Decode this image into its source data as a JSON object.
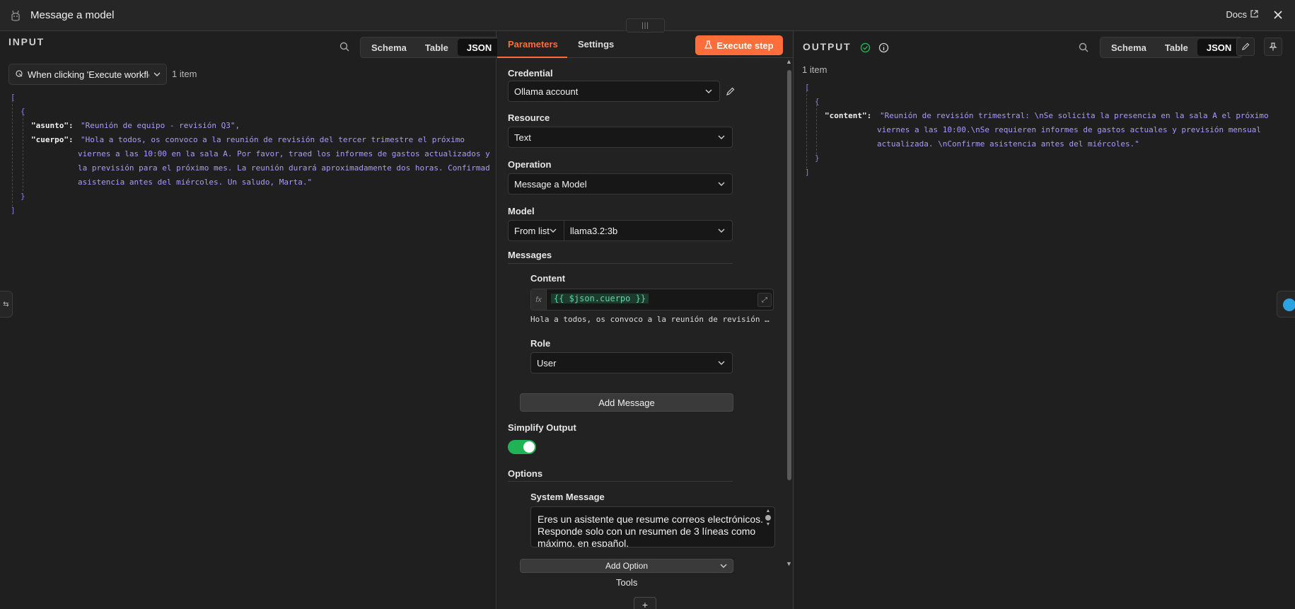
{
  "window": {
    "title": "Message a model",
    "docs_label": "Docs"
  },
  "view_tabs": [
    "Schema",
    "Table",
    "JSON"
  ],
  "input": {
    "label": "INPUT",
    "trigger_select": "When clicking 'Execute workflow'",
    "item_count": "1 item",
    "json": {
      "open_array": "[",
      "open_obj": "{",
      "asunto_key": "\"asunto\":",
      "asunto_val": "\"Reunión de equipo - revisión Q3\",",
      "cuerpo_key": "\"cuerpo\":",
      "cuerpo_lines": [
        "\"Hola a todos, os convoco a la reunión de revisión del tercer trimestre el próximo",
        "viernes a las 10:00 en la sala A. Por favor, traed los informes de gastos actualizados y",
        "la previsión para el próximo mes. La reunión durará aproximadamente dos horas. Confirmad",
        "asistencia antes del miércoles. Un saludo, Marta.\""
      ],
      "close_obj": "}",
      "close_array": "]"
    }
  },
  "params": {
    "tabs": {
      "parameters": "Parameters",
      "settings": "Settings"
    },
    "execute_label": "Execute step",
    "credential": {
      "label": "Credential",
      "value": "Ollama account"
    },
    "resource": {
      "label": "Resource",
      "value": "Text"
    },
    "operation": {
      "label": "Operation",
      "value": "Message a Model"
    },
    "model": {
      "label": "Model",
      "mode": "From list",
      "value": "llama3.2:3b"
    },
    "messages": {
      "label": "Messages",
      "content_label": "Content",
      "expression": "{{ $json.cuerpo }}",
      "preview": "Hola a todos, os convoco a la reunión de revisión …",
      "role_label": "Role",
      "role_value": "User",
      "add_label": "Add Message"
    },
    "simplify": {
      "label": "Simplify Output",
      "on": true
    },
    "options": {
      "label": "Options",
      "system_message_label": "System Message",
      "system_message": "Eres un asistente que resume correos electrónicos. Responde solo con un resumen de 3 líneas como máximo, en español.",
      "add_label": "Add Option"
    },
    "tools_label": "Tools",
    "plus": "+"
  },
  "output": {
    "label": "OUTPUT",
    "item_count": "1 item",
    "json": {
      "open_array": "[",
      "open_obj": "{",
      "content_key": "\"content\":",
      "content_lines": [
        "\"Reunión de revisión trimestral: \\nSe solicita la presencia en la sala A el próximo",
        "viernes a las 10:00.\\nSe requieren informes de gastos actuales y previsión mensual",
        "actualizada. \\nConfirme asistencia antes del miércoles.\""
      ],
      "close_obj": "}",
      "close_array": "]"
    }
  },
  "colors": {
    "accent": "#ff6d3a",
    "success": "#1fb355",
    "json_string": "#a99bfa",
    "json_bracket": "#8e7cf7"
  }
}
